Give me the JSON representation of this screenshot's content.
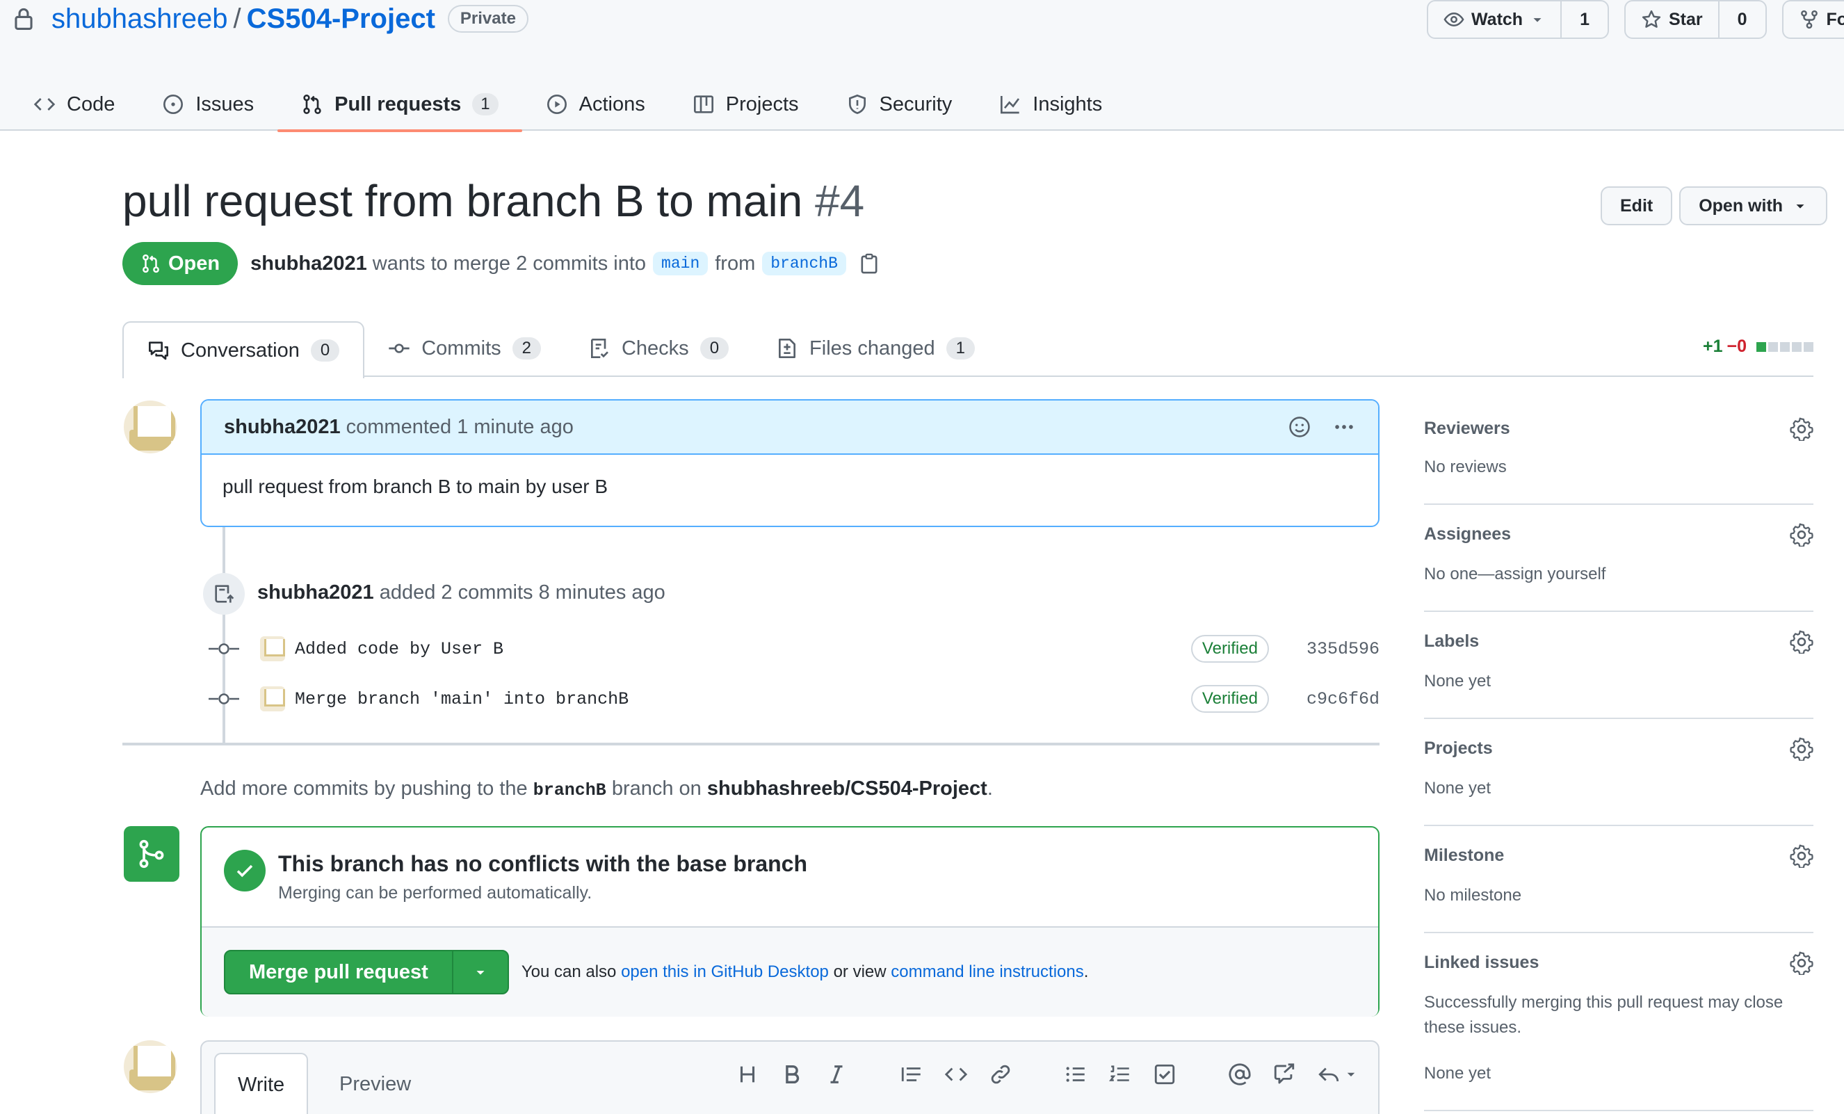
{
  "repo": {
    "owner": "shubhashreeb",
    "separator": "/",
    "name": "CS504-Project",
    "visibility": "Private",
    "watch_label": "Watch",
    "watch_count": "1",
    "star_label": "Star",
    "star_count": "0",
    "fork_label": "Fo"
  },
  "nav": {
    "code": "Code",
    "issues": "Issues",
    "pulls": "Pull requests",
    "pulls_count": "1",
    "actions": "Actions",
    "projects": "Projects",
    "security": "Security",
    "insights": "Insights"
  },
  "pr": {
    "title": "pull request from branch B to main",
    "number": "#4",
    "edit_label": "Edit",
    "open_with_label": "Open with",
    "state": "Open",
    "author": "shubha2021",
    "meta_text": "wants to merge 2 commits into",
    "base_branch": "main",
    "from_text": "from",
    "head_branch": "branchB"
  },
  "tabs": {
    "conversation": "Conversation",
    "conversation_count": "0",
    "commits": "Commits",
    "commits_count": "2",
    "checks": "Checks",
    "checks_count": "0",
    "files": "Files changed",
    "files_count": "1",
    "additions": "+1",
    "deletions": "−0"
  },
  "comment": {
    "author": "shubha2021",
    "action": "commented 1 minute ago",
    "body": "pull request from branch B to main by user B"
  },
  "push_event": {
    "author": "shubha2021",
    "text": "added 2 commits 8 minutes ago"
  },
  "commits": [
    {
      "message": "Added code by User B",
      "badge": "Verified",
      "sha": "335d596"
    },
    {
      "message": "Merge branch 'main' into branchB",
      "badge": "Verified",
      "sha": "c9c6f6d"
    }
  ],
  "hint": {
    "prefix": "Add more commits by pushing to the",
    "branch": "branchB",
    "middle": "branch on",
    "repo": "shubhashreeb/CS504-Project",
    "suffix": "."
  },
  "merge": {
    "title": "This branch has no conflicts with the base branch",
    "subtitle": "Merging can be performed automatically.",
    "button": "Merge pull request",
    "hint_prefix": "You can also",
    "link_desktop": "open this in GitHub Desktop",
    "hint_middle": "or view",
    "link_cli": "command line instructions",
    "hint_suffix": "."
  },
  "editor": {
    "write_tab": "Write",
    "preview_tab": "Preview"
  },
  "sidebar": {
    "reviewers_title": "Reviewers",
    "reviewers_value": "No reviews",
    "assignees_title": "Assignees",
    "assignees_value": "No one—assign yourself",
    "labels_title": "Labels",
    "labels_value": "None yet",
    "projects_title": "Projects",
    "projects_value": "None yet",
    "milestone_title": "Milestone",
    "milestone_value": "No milestone",
    "linked_title": "Linked issues",
    "linked_desc": "Successfully merging this pull request may close these issues.",
    "linked_value": "None yet"
  },
  "colors": {
    "accent_blue": "#0969da",
    "open_green": "#2da44e",
    "nav_underline": "#fd8c73",
    "deletion_red": "#cf222e"
  }
}
